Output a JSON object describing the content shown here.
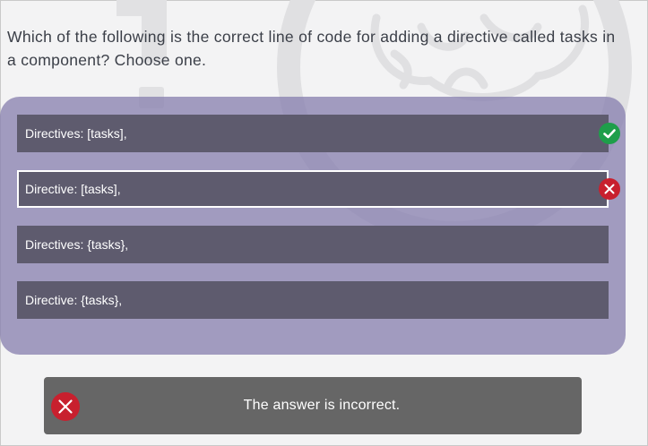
{
  "question": {
    "text": "Which of the following is the correct line of code for adding a directive called tasks in a component? Choose one."
  },
  "options": [
    {
      "label": "Directives: [tasks],",
      "status": "correct"
    },
    {
      "label": "Directive: [tasks],",
      "status": "incorrect-selected"
    },
    {
      "label": "Directives: {tasks},",
      "status": "none"
    },
    {
      "label": "Directive: {tasks},",
      "status": "none"
    }
  ],
  "feedback": {
    "text": "The answer is incorrect.",
    "icon": "error-x-icon"
  },
  "colors": {
    "correct": "#1e9e4a",
    "incorrect": "#c8202e",
    "panel": "#8982af",
    "option": "#5e5b6e"
  }
}
